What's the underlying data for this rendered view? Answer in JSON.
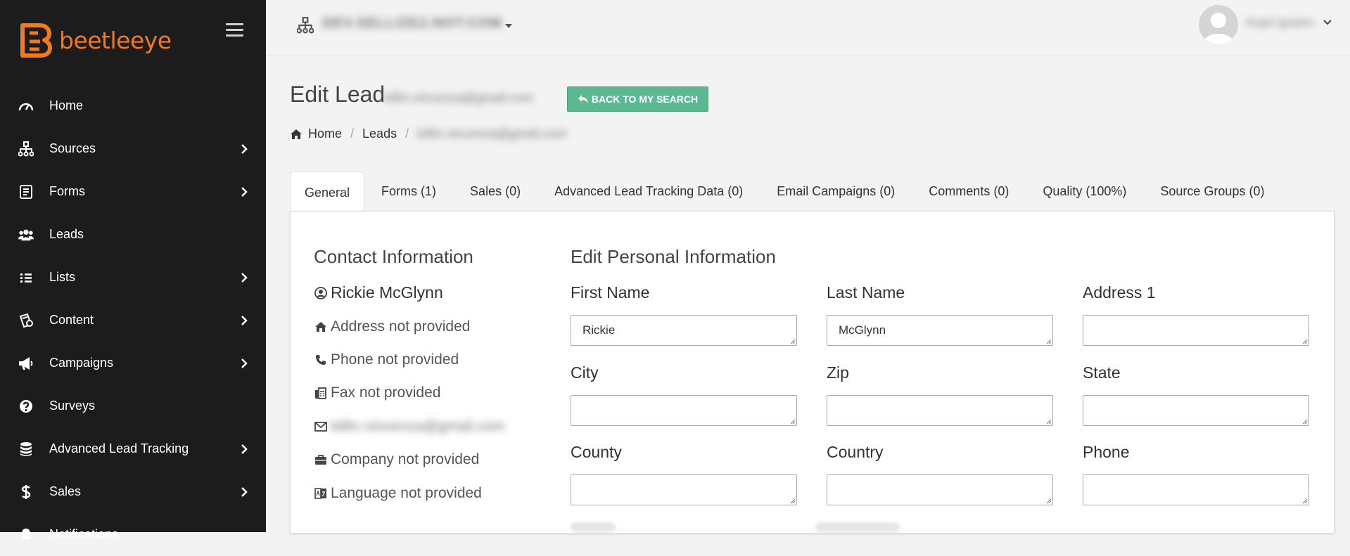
{
  "app": {
    "logo_text": "beetleeye",
    "brand_color": "#f07a1e",
    "accent_color": "#5cb891"
  },
  "sidebar": {
    "menu_icon": "hamburger-icon",
    "items": [
      {
        "label": "Home",
        "icon": "dashboard-icon",
        "has_submenu": false
      },
      {
        "label": "Sources",
        "icon": "sitemap-icon",
        "has_submenu": true
      },
      {
        "label": "Forms",
        "icon": "form-icon",
        "has_submenu": true
      },
      {
        "label": "Leads",
        "icon": "users-icon",
        "has_submenu": false
      },
      {
        "label": "Lists",
        "icon": "list-icon",
        "has_submenu": true
      },
      {
        "label": "Content",
        "icon": "content-icon",
        "has_submenu": true
      },
      {
        "label": "Campaigns",
        "icon": "megaphone-icon",
        "has_submenu": true
      },
      {
        "label": "Surveys",
        "icon": "question-circle-icon",
        "has_submenu": false
      },
      {
        "label": "Advanced Lead Tracking",
        "icon": "database-icon",
        "has_submenu": true
      },
      {
        "label": "Sales",
        "icon": "dollar-icon",
        "has_submenu": true
      },
      {
        "label": "Notifications",
        "icon": "bell-icon",
        "has_submenu": false
      }
    ]
  },
  "topbar": {
    "org_name": "DEV.SELLIZE2.NOT.COM",
    "user_name": "Angel Ignatov"
  },
  "page": {
    "title": "Edit Lead",
    "title_email": "kitlin.vincenza@gmail.com",
    "back_button": "BACK TO MY SEARCH",
    "breadcrumb": {
      "home": "Home",
      "leads": "Leads",
      "current": "kitlin.vincenza@gmail.com"
    }
  },
  "tabs": [
    {
      "label": "General",
      "active": true
    },
    {
      "label": "Forms (1)",
      "active": false
    },
    {
      "label": "Sales (0)",
      "active": false
    },
    {
      "label": "Advanced Lead Tracking Data (0)",
      "active": false
    },
    {
      "label": "Email Campaigns (0)",
      "active": false
    },
    {
      "label": "Comments (0)",
      "active": false
    },
    {
      "label": "Quality (100%)",
      "active": false
    },
    {
      "label": "Source Groups (0)",
      "active": false
    }
  ],
  "contact": {
    "title": "Contact Information",
    "name": "Rickie McGlynn",
    "address": "Address not provided",
    "phone": "Phone not provided",
    "fax": "Fax not provided",
    "email": "kitlin.vincenza@gmail.com",
    "company": "Company not provided",
    "language": "Language not provided"
  },
  "personal": {
    "title": "Edit Personal Information",
    "fields": [
      {
        "label": "First Name",
        "value": "Rickie"
      },
      {
        "label": "Last Name",
        "value": "McGlynn"
      },
      {
        "label": "Address 1",
        "value": ""
      },
      {
        "label": "City",
        "value": ""
      },
      {
        "label": "Zip",
        "value": ""
      },
      {
        "label": "State",
        "value": ""
      },
      {
        "label": "County",
        "value": ""
      },
      {
        "label": "Country",
        "value": ""
      },
      {
        "label": "Phone",
        "value": ""
      }
    ]
  }
}
